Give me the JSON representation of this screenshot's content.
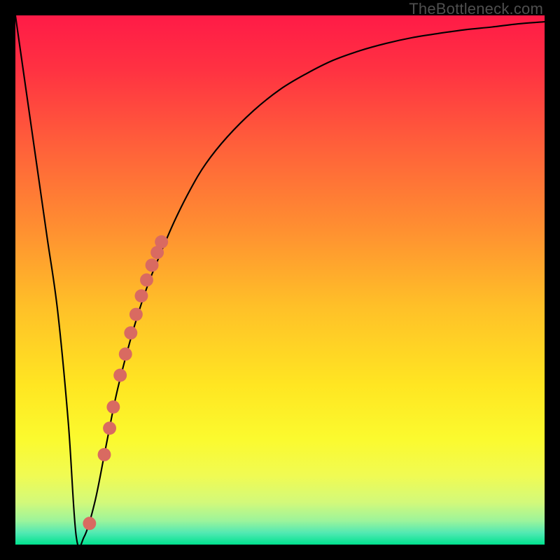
{
  "watermark": "TheBottleneck.com",
  "colors": {
    "frame": "#000000",
    "curve_stroke": "#000000",
    "marker_fill": "#d96a61",
    "gradient_stops": [
      {
        "offset": 0.0,
        "color": "#ff1b47"
      },
      {
        "offset": 0.1,
        "color": "#ff3142"
      },
      {
        "offset": 0.25,
        "color": "#ff613a"
      },
      {
        "offset": 0.4,
        "color": "#ff8e31"
      },
      {
        "offset": 0.55,
        "color": "#ffc028"
      },
      {
        "offset": 0.7,
        "color": "#ffe622"
      },
      {
        "offset": 0.8,
        "color": "#fbfa2e"
      },
      {
        "offset": 0.87,
        "color": "#f0fb53"
      },
      {
        "offset": 0.92,
        "color": "#d3f97a"
      },
      {
        "offset": 0.955,
        "color": "#9cf49b"
      },
      {
        "offset": 0.978,
        "color": "#51e9b3"
      },
      {
        "offset": 1.0,
        "color": "#00e28e"
      }
    ]
  },
  "chart_data": {
    "type": "line",
    "title": "",
    "xlabel": "",
    "ylabel": "",
    "xlim": [
      0,
      100
    ],
    "ylim": [
      0,
      100
    ],
    "grid": false,
    "series": [
      {
        "name": "bottleneck-curve",
        "x": [
          0,
          2,
          4,
          6,
          8,
          10,
          11.5,
          13,
          15,
          17,
          19,
          21,
          23,
          25,
          27,
          30,
          33,
          36,
          40,
          45,
          50,
          55,
          60,
          65,
          70,
          75,
          80,
          85,
          90,
          95,
          100
        ],
        "y": [
          100,
          86,
          72,
          58,
          44,
          23,
          1.5,
          1.5,
          8,
          18,
          28,
          36,
          43,
          49,
          54,
          61,
          67,
          72,
          77,
          82,
          86,
          89,
          91.5,
          93.3,
          94.7,
          95.8,
          96.6,
          97.3,
          97.8,
          98.4,
          98.8
        ]
      }
    ],
    "markers": {
      "name": "highlighted-points",
      "x": [
        14.0,
        16.8,
        17.8,
        18.5,
        19.8,
        20.8,
        21.8,
        22.8,
        23.8,
        24.8,
        25.8,
        26.8,
        27.6
      ],
      "y": [
        4.0,
        17.0,
        22.0,
        26.0,
        32.0,
        36.0,
        40.0,
        43.5,
        47.0,
        50.0,
        52.8,
        55.2,
        57.2
      ]
    },
    "note": "x/y expressed as percentage of plot width/height; y=0 is bottom (good), y=100 is top."
  }
}
